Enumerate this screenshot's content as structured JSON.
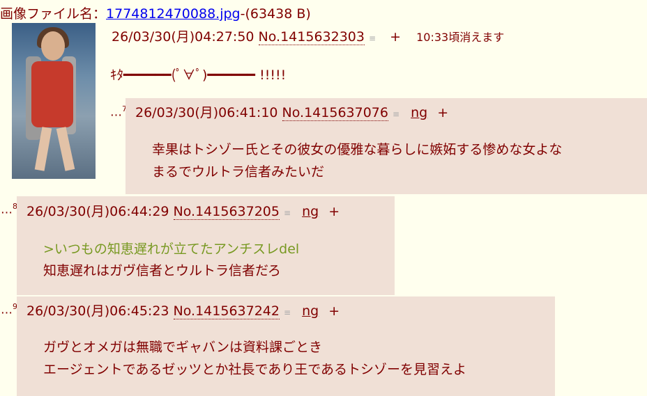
{
  "op": {
    "file_label": "画像ファイル名：",
    "file_name": "1774812470088.jpg",
    "file_size": "-(63438 B)",
    "date": "26/03/30(月)04:27:50",
    "no": "No.1415632303",
    "del": "≡",
    "plus": "+",
    "expire": "10:33頃消えます",
    "body": "ｷﾀ━━━━━━(ﾟ∀ﾟ)━━━━━━ !!!!!"
  },
  "replies": [
    {
      "dots": "…",
      "num": "7",
      "date": "26/03/30(月)06:41:10",
      "no": "No.1415637076",
      "del": "≡",
      "ng": "ng",
      "plus": "+",
      "lines": [
        "幸果はトシゾー氏とその彼女の優雅な暮らしに嫉妬する惨めな女よな",
        "まるでウルトラ信者みたいだ"
      ]
    },
    {
      "dots": "…",
      "num": "8",
      "date": "26/03/30(月)06:44:29",
      "no": "No.1415637205",
      "del": "≡",
      "ng": "ng",
      "plus": "+",
      "quote": ">いつもの知恵遅れが立てたアンチスレdel",
      "lines": [
        "知恵遅れはガヴ信者とウルトラ信者だろ"
      ]
    },
    {
      "dots": "…",
      "num": "9",
      "date": "26/03/30(月)06:45:23",
      "no": "No.1415637242",
      "del": "≡",
      "ng": "ng",
      "plus": "+",
      "lines": [
        "ガヴとオメガは無職でギャバンは資料課ごとき",
        "エージェントであるゼッツとか社長であり王であるトシゾーを見習えよ"
      ]
    }
  ]
}
